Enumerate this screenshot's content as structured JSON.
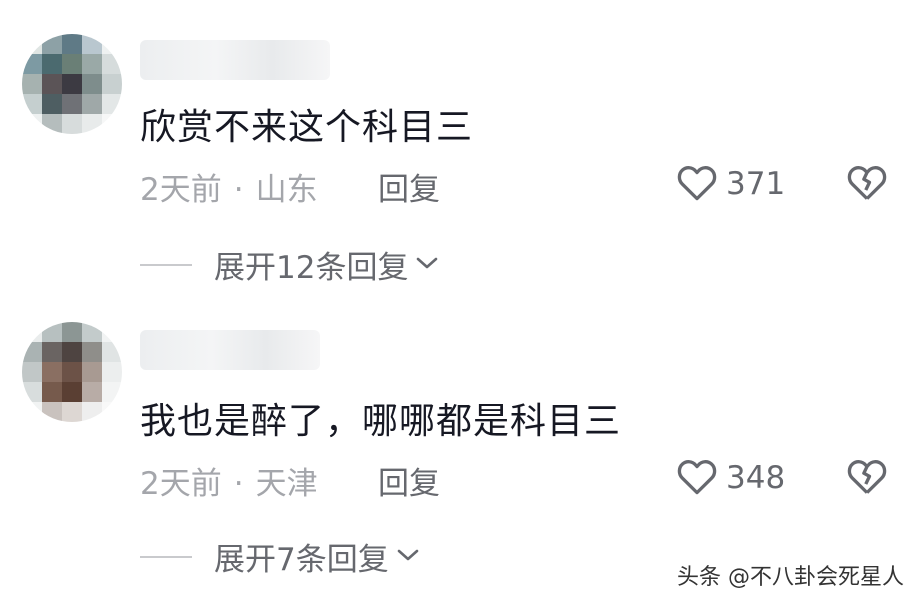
{
  "comments": [
    {
      "text": "欣赏不来这个科目三",
      "time": "2天前",
      "separator": "·",
      "location": "山东",
      "reply_label": "回复",
      "like_count": "371",
      "expand_label": "展开12条回复"
    },
    {
      "text": "我也是醉了，哪哪都是科目三",
      "time": "2天前",
      "separator": "·",
      "location": "天津",
      "reply_label": "回复",
      "like_count": "348",
      "expand_label": "展开7条回复"
    }
  ],
  "watermark": "头条 @不八卦会死星人",
  "icons": {
    "like": "heart-outline-icon",
    "dislike": "broken-heart-icon",
    "expand": "chevron-down-icon"
  },
  "colors": {
    "text_primary": "#161823",
    "text_secondary": "#a4a6ab",
    "text_action": "#66686e"
  }
}
